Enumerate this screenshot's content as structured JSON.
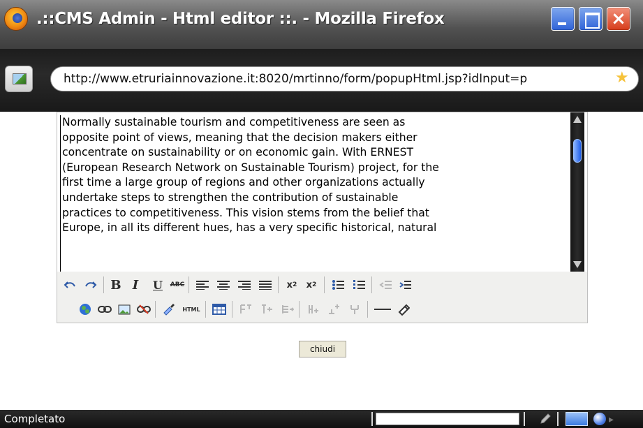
{
  "window": {
    "title": ".::CMS Admin - Html editor ::. - Mozilla Firefox",
    "controls": {
      "minimize": "minimize",
      "maximize": "maximize",
      "close": "close"
    }
  },
  "address_bar": {
    "url": "http://www.etruriainnovazione.it:8020/mrtinno/form/popupHtml.jsp?idInput=p",
    "site_icon": "image-icon",
    "bookmark_icon": "star-icon"
  },
  "editor": {
    "text_lines": [
      "Normally sustainable tourism and competitiveness are seen as",
      "opposite point of views, meaning that the decision makers either",
      "concentrate on sustainability or on economic gain. With ERNEST",
      "(European Research Network on Sustainable Tourism) project, for the",
      "first time a large group of regions and other organizations actually",
      "undertake steps to strengthen the contribution of sustainable",
      "practices to competitiveness. This vision stems from the belief that",
      "Europe, in all its different hues, has a very specific historical, natural"
    ],
    "toolbar": {
      "row1": [
        {
          "name": "undo-icon",
          "label": "↶"
        },
        {
          "name": "redo-icon",
          "label": "↷"
        },
        {
          "name": "bold-icon",
          "label": "B"
        },
        {
          "name": "italic-icon",
          "label": "I"
        },
        {
          "name": "underline-icon",
          "label": "U"
        },
        {
          "name": "strikethrough-icon",
          "label": "ABC"
        },
        {
          "name": "align-left-icon",
          "label": ""
        },
        {
          "name": "align-center-icon",
          "label": ""
        },
        {
          "name": "align-right-icon",
          "label": ""
        },
        {
          "name": "align-justify-icon",
          "label": ""
        },
        {
          "name": "subscript-icon",
          "label": "x₂"
        },
        {
          "name": "superscript-icon",
          "label": "x²"
        },
        {
          "name": "bullet-list-icon",
          "label": ""
        },
        {
          "name": "numbered-list-icon",
          "label": ""
        },
        {
          "name": "outdent-icon",
          "label": ""
        },
        {
          "name": "indent-icon",
          "label": ""
        }
      ],
      "row2": [
        {
          "name": "anchor-globe-icon",
          "label": ""
        },
        {
          "name": "link-icon",
          "label": ""
        },
        {
          "name": "image-icon",
          "label": ""
        },
        {
          "name": "unlink-icon",
          "label": ""
        },
        {
          "name": "cleanup-brush-icon",
          "label": ""
        },
        {
          "name": "html-source-icon",
          "label": "HTML"
        },
        {
          "name": "table-icon",
          "label": ""
        },
        {
          "name": "row-props-icon",
          "label": ""
        },
        {
          "name": "insert-row-before-icon",
          "label": ""
        },
        {
          "name": "insert-row-after-icon",
          "label": ""
        },
        {
          "name": "split-cells-icon",
          "label": ""
        },
        {
          "name": "merge-cells-icon",
          "label": ""
        },
        {
          "name": "delete-col-icon",
          "label": ""
        },
        {
          "name": "horizontal-rule-icon",
          "label": ""
        },
        {
          "name": "eraser-icon",
          "label": ""
        }
      ]
    }
  },
  "actions": {
    "close_label": "chiudi"
  },
  "statusbar": {
    "text": "Completato"
  }
}
